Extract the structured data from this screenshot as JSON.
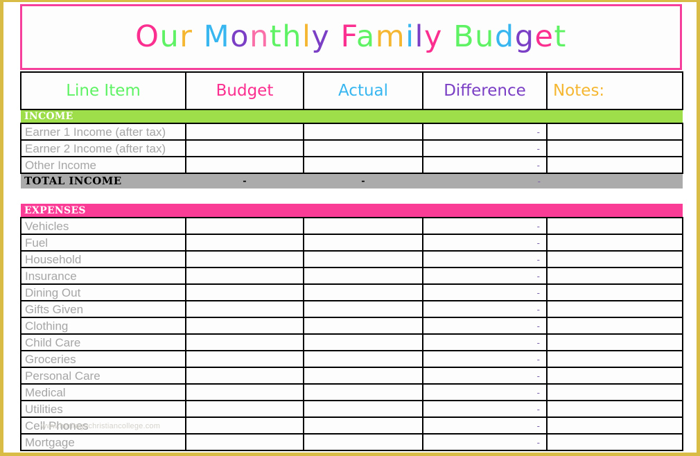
{
  "title": {
    "full_text": "Our Monthly Family Budget",
    "letters": [
      {
        "ch": "O",
        "color": "#fa2f8f"
      },
      {
        "ch": "u",
        "color": "#5ef264"
      },
      {
        "ch": "r",
        "color": "#f5b731"
      },
      {
        "ch": " ",
        "color": "#000000"
      },
      {
        "ch": "M",
        "color": "#37b6f0"
      },
      {
        "ch": "o",
        "color": "#7a3fc4"
      },
      {
        "ch": "n",
        "color": "#fa6fa8"
      },
      {
        "ch": "t",
        "color": "#5ef264"
      },
      {
        "ch": "h",
        "color": "#5ef264"
      },
      {
        "ch": "l",
        "color": "#f5b731"
      },
      {
        "ch": "y",
        "color": "#7a3fc4"
      },
      {
        "ch": " ",
        "color": "#000000"
      },
      {
        "ch": "F",
        "color": "#fa2f8f"
      },
      {
        "ch": "a",
        "color": "#5ef264"
      },
      {
        "ch": "m",
        "color": "#f5b731"
      },
      {
        "ch": "i",
        "color": "#37b6f0"
      },
      {
        "ch": "l",
        "color": "#7a3fc4"
      },
      {
        "ch": "y",
        "color": "#fa2f8f"
      },
      {
        "ch": " ",
        "color": "#000000"
      },
      {
        "ch": "B",
        "color": "#5ef264"
      },
      {
        "ch": "u",
        "color": "#5ef264"
      },
      {
        "ch": "d",
        "color": "#37b6f0"
      },
      {
        "ch": "g",
        "color": "#7a3fc4"
      },
      {
        "ch": "e",
        "color": "#fa2f8f"
      },
      {
        "ch": "t",
        "color": "#5ef264"
      }
    ]
  },
  "columns": {
    "line_item": "Line Item",
    "budget": "Budget",
    "actual": "Actual",
    "difference": "Difference",
    "notes": "Notes:"
  },
  "colors": {
    "income_bar": "#9EDE4A",
    "expenses_bar": "#FA3C96",
    "total_bar": "#ababab",
    "frame": "#d9bc46",
    "title_border": "#f53f9a",
    "row_label": "#a6a6a6",
    "difference_value": "#7a5fa8"
  },
  "sections": [
    {
      "name": "income",
      "heading": "INCOME",
      "rows": [
        {
          "label": "Earner 1 Income (after tax)",
          "budget": "",
          "actual": "",
          "difference": "-",
          "notes": ""
        },
        {
          "label": "Earner 2 Income (after tax)",
          "budget": "",
          "actual": "",
          "difference": "-",
          "notes": ""
        },
        {
          "label": "Other Income",
          "budget": "",
          "actual": "",
          "difference": "-",
          "notes": ""
        }
      ],
      "total": {
        "label": "TOTAL  INCOME",
        "budget": "-",
        "actual": "-",
        "difference": "-",
        "notes": ""
      }
    },
    {
      "name": "expenses",
      "heading": "EXPENSES",
      "rows": [
        {
          "label": "Vehicles",
          "budget": "",
          "actual": "",
          "difference": "-",
          "notes": ""
        },
        {
          "label": "Fuel",
          "budget": "",
          "actual": "",
          "difference": "-",
          "notes": ""
        },
        {
          "label": "Household",
          "budget": "",
          "actual": "",
          "difference": "-",
          "notes": ""
        },
        {
          "label": "Insurance",
          "budget": "",
          "actual": "",
          "difference": "-",
          "notes": ""
        },
        {
          "label": "Dining Out",
          "budget": "",
          "actual": "",
          "difference": "-",
          "notes": ""
        },
        {
          "label": "Gifts Given",
          "budget": "",
          "actual": "",
          "difference": "-",
          "notes": ""
        },
        {
          "label": "Clothing",
          "budget": "",
          "actual": "",
          "difference": "-",
          "notes": ""
        },
        {
          "label": "Child Care",
          "budget": "",
          "actual": "",
          "difference": "-",
          "notes": ""
        },
        {
          "label": "Groceries",
          "budget": "",
          "actual": "",
          "difference": "-",
          "notes": ""
        },
        {
          "label": "Personal Care",
          "budget": "",
          "actual": "",
          "difference": "-",
          "notes": ""
        },
        {
          "label": "Medical",
          "budget": "",
          "actual": "",
          "difference": "-",
          "notes": ""
        },
        {
          "label": "Utilities",
          "budget": "",
          "actual": "",
          "difference": "-",
          "notes": ""
        },
        {
          "label": "Cell Phones",
          "budget": "",
          "actual": "",
          "difference": "-",
          "notes": ""
        },
        {
          "label": "Mortgage",
          "budget": "",
          "actual": "",
          "difference": "-",
          "notes": ""
        }
      ]
    }
  ],
  "watermark": "www.heritagechristiancollege.com"
}
